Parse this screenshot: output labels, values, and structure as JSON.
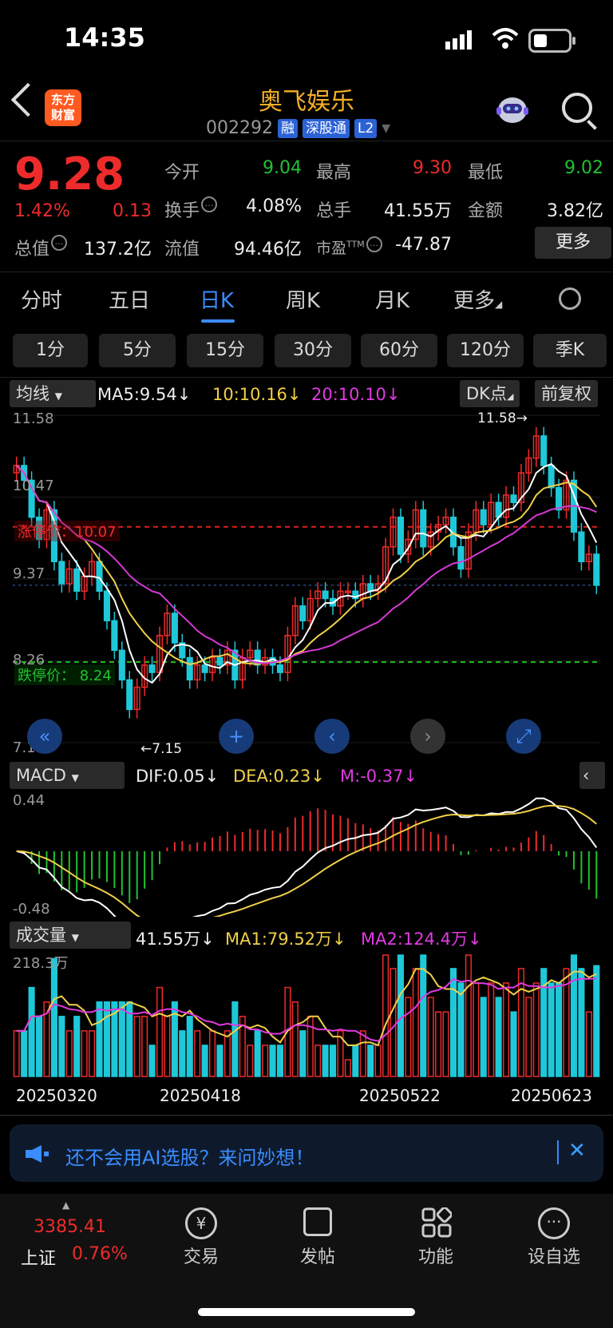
{
  "status": {
    "time": "14:35"
  },
  "header": {
    "title": "奥飞娱乐",
    "logo_text": "东方\n财富",
    "code": "002292",
    "tags": [
      "融",
      "深股通",
      "L2"
    ]
  },
  "quote": {
    "price": "9.28",
    "change_pct": "1.42%",
    "change": "0.13",
    "open_label": "今开",
    "open": "9.04",
    "high_label": "最高",
    "high": "9.30",
    "low_label": "最低",
    "low": "9.02",
    "turnover_label": "换手",
    "turnover": "4.08%",
    "volume_label": "总手",
    "volume": "41.55万",
    "amount_label": "金额",
    "amount": "3.82亿",
    "mcap_label": "总值",
    "mcap": "137.2亿",
    "float_label": "流值",
    "float": "94.46亿",
    "pe_label": "市盈",
    "pe_sup": "TTM",
    "pe": "-47.87",
    "more": "更多"
  },
  "tabs": [
    "分时",
    "五日",
    "日K",
    "周K",
    "月K",
    "更多"
  ],
  "periods": [
    "1分",
    "5分",
    "15分",
    "30分",
    "60分",
    "120分",
    "季K"
  ],
  "kline": {
    "ma_selector": "均线",
    "ma5": "MA5:9.54",
    "ma10": "10:10.16",
    "ma20": "20:10.10",
    "dk": "DK点",
    "adjust": "前复权",
    "y_top": "11.58",
    "y_2": "10.47",
    "y_3": "9.37",
    "y_4": "8.26",
    "y_bottom": "7.15",
    "limit_up": "涨停价：10.07",
    "limit_down": "跌停价： 8.24",
    "max_note": "11.58",
    "min_note": "7.15",
    "colors": {
      "up": "#ee2b2b",
      "down": "#1fc8d8",
      "ma5": "#ffffff",
      "ma10": "#f0d048",
      "ma20": "#d43ad4"
    }
  },
  "macd": {
    "label": "MACD",
    "dif": "DIF:0.05",
    "dea": "DEA:0.23",
    "m": "M:-0.37",
    "y_top": "0.44",
    "y_bottom": "-0.48"
  },
  "volume": {
    "label": "成交量",
    "vol": "41.55万",
    "ma1": "MA1:79.52万",
    "ma2": "MA2:124.4万",
    "y_top": "218.3万"
  },
  "dates": [
    "20250320",
    "20250418",
    "20250522",
    "20250623"
  ],
  "banner": {
    "text": "还不会用AI选股？来问妙想！"
  },
  "bottom_nav": {
    "index_value": "3385.41",
    "index_name": "上证",
    "index_change": "0.76%",
    "items": [
      "交易",
      "发帖",
      "功能",
      "设自选"
    ]
  },
  "chart_data": {
    "type": "candlestick",
    "title": "",
    "y_range": [
      7.15,
      11.58
    ],
    "x_dates_shown": [
      "20250320",
      "20250418",
      "20250522",
      "20250623"
    ],
    "closes": [
      10.9,
      10.7,
      10.2,
      9.9,
      10.3,
      9.6,
      9.3,
      9.5,
      9.2,
      9.4,
      9.6,
      9.2,
      8.8,
      8.4,
      8.0,
      7.6,
      7.9,
      8.2,
      8.1,
      8.6,
      8.9,
      8.5,
      8.3,
      8.0,
      8.2,
      8.1,
      8.3,
      8.2,
      8.4,
      8.0,
      8.3,
      8.4,
      8.2,
      8.3,
      8.2,
      8.1,
      8.6,
      9.0,
      8.8,
      9.1,
      9.2,
      9.1,
      9.0,
      9.2,
      9.2,
      9.1,
      9.3,
      9.2,
      9.3,
      9.8,
      10.2,
      9.7,
      9.9,
      10.3,
      9.8,
      10.0,
      10.1,
      10.2,
      9.8,
      9.5,
      10.0,
      10.3,
      10.1,
      10.4,
      10.2,
      10.5,
      10.4,
      10.8,
      11.0,
      11.3,
      10.9,
      10.6,
      10.3,
      10.7,
      10.0,
      9.6,
      9.7,
      9.28
    ],
    "macd": {
      "dif_last": 0.05,
      "dea_last": 0.23,
      "m_last": -0.37
    },
    "volume": {
      "vol_last_wan": 41.55,
      "ma1_wan": 79.52,
      "ma2_wan": 124.4,
      "max_wan": 218.3
    }
  }
}
